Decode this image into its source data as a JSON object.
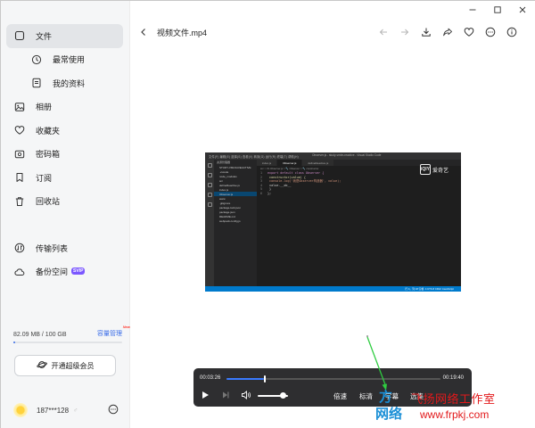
{
  "window": {
    "controls": [
      "minimize-icon",
      "maximize-icon",
      "close-icon"
    ]
  },
  "sidebar": {
    "items": [
      {
        "label": "文件",
        "icon": "file-icon",
        "active": true
      },
      {
        "label": "最常使用",
        "icon": "clock-icon",
        "sub": true
      },
      {
        "label": "我的资料",
        "icon": "document-icon",
        "sub": true
      },
      {
        "label": "相册",
        "icon": "image-icon"
      },
      {
        "label": "收藏夹",
        "icon": "heart-icon"
      },
      {
        "label": "密码箱",
        "icon": "safe-icon"
      },
      {
        "label": "订阅",
        "icon": "bookmark-icon"
      },
      {
        "label": "回收站",
        "icon": "trash-icon"
      },
      {
        "label": "传输列表",
        "icon": "transfer-icon"
      },
      {
        "label": "备份空间",
        "icon": "cloud-icon",
        "badge": "SVIP"
      }
    ],
    "storage": {
      "text": "82.09 MB / 100 GB",
      "manage": "容量管理",
      "new_tag": "New",
      "used_fraction": 0.0008
    },
    "vip_button": "开通超级会员",
    "user": {
      "name": "187***128",
      "gender": "♂"
    }
  },
  "viewer": {
    "file_title": "视频文件.mp4",
    "tools": [
      "prev-icon",
      "next-icon",
      "download-icon",
      "share-icon",
      "favorite-icon",
      "more-icon",
      "info-icon"
    ]
  },
  "video_frame": {
    "menu": "文件(F)  编辑(E)  选择(S)  查看(V)  转到(G)  运行(R)  终端(T)  帮助(H)",
    "window_title": "Observer.js - study-vmlm-reactive - Visual Studio Code",
    "explorer_title": "资源管理器",
    "explorer_files": [
      "STUDY-VMLM-REACTIVE",
      ".vscode",
      "node_modules",
      "src",
      "defineReactive.js",
      "index.js",
      "Observer.js",
      "www",
      ".gitignore",
      "package-lock.json",
      "package.json",
      "README.md",
      "webpack.config.js"
    ],
    "tabs": [
      "index.js",
      "Observer.js",
      "defineReactive.js"
    ],
    "breadcrumb": "src > JS Observer.js > 🔧 Observer > 🔧 constructor",
    "code": [
      {
        "n": "1",
        "t": "export default class Observer {"
      },
      {
        "n": "2",
        "t": "    constructor(value) {"
      },
      {
        "n": "3",
        "t": "        console.log('我是Observer构造器', value);"
      },
      {
        "n": "4",
        "t": "        value.__ob__"
      },
      {
        "n": "5",
        "t": "    }"
      },
      {
        "n": "6",
        "t": "};"
      }
    ],
    "logo_text": "爱奇艺",
    "logo_mark": "iQIY",
    "status": "行 4，列 18  空格: 4  UTF-8  CRLF  JavaScript"
  },
  "player": {
    "current_time": "00:03:26",
    "total_time": "00:19:40",
    "progress_fraction": 0.175,
    "volume_fraction": 0.85,
    "speed_label": "倍速",
    "quality_label": "标清",
    "subtitle_label": "字幕",
    "episodes_label": "选集"
  },
  "watermark": {
    "logo_line1": "方",
    "logo_line2": "网络",
    "name": "飞扬网络工作室",
    "url": "www.frpkj.com"
  }
}
